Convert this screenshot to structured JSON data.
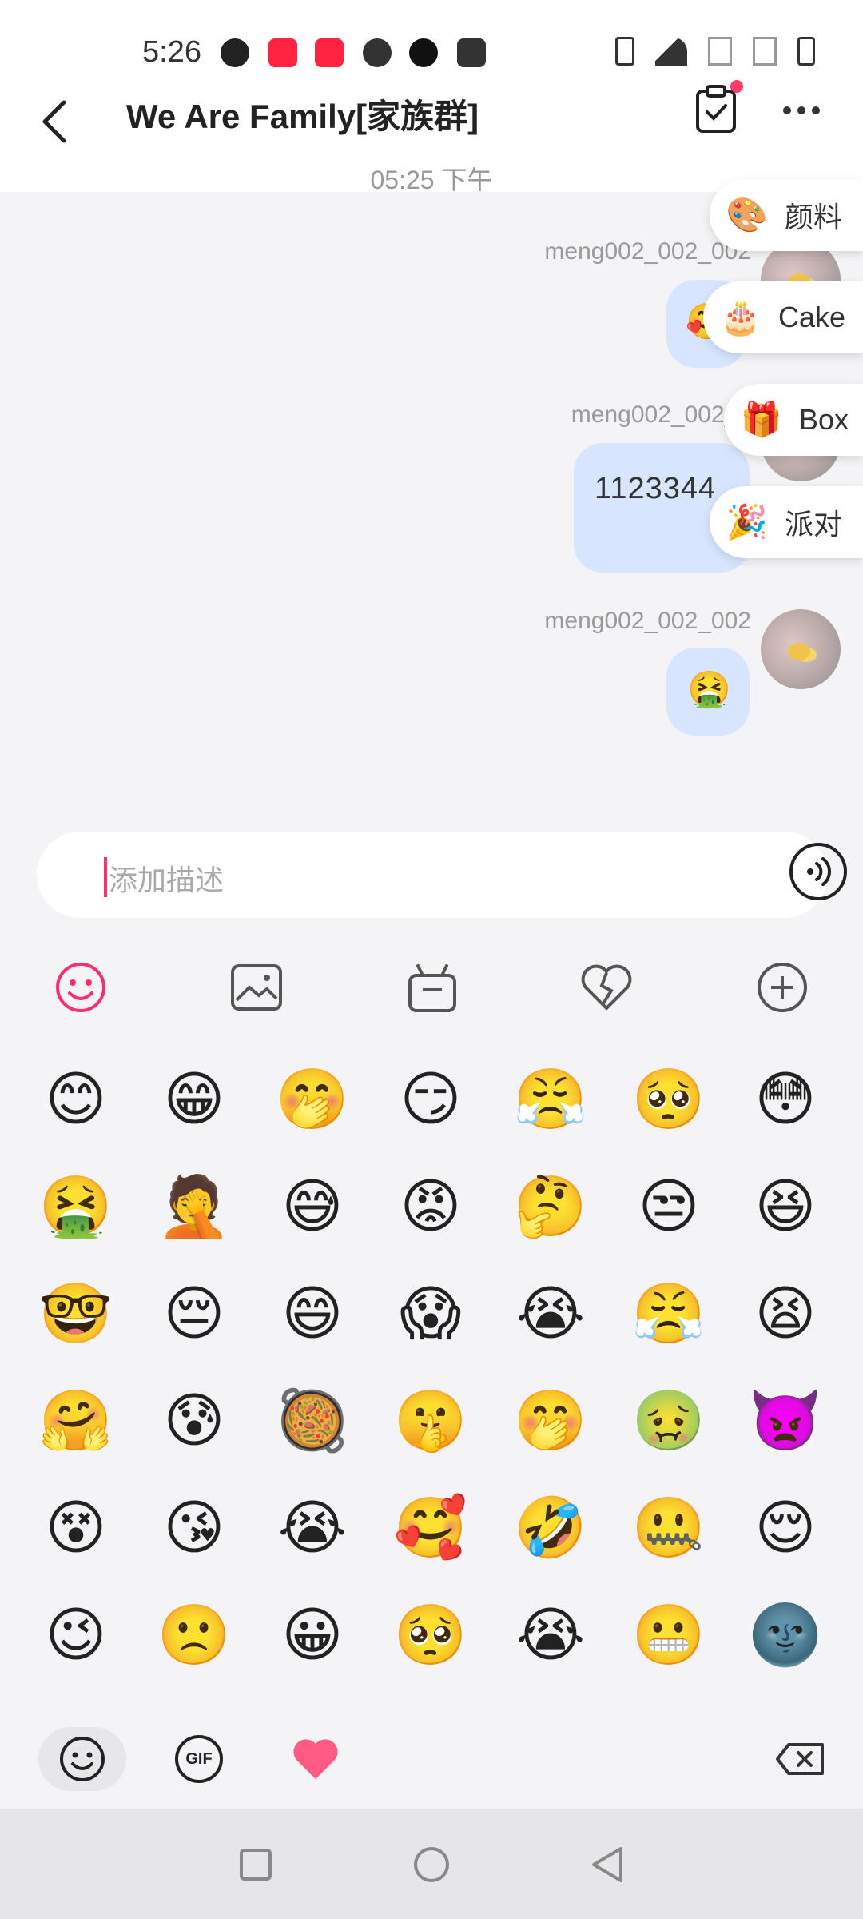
{
  "status_bar": {
    "time": "5:26",
    "apps": [
      "profile-app-icon",
      "xiaohongshu-icon",
      "xiaohongshu-icon",
      "facebook-icon",
      "tiktok-icon",
      "wallet-icon"
    ],
    "system": [
      "vibrate-icon",
      "wifi-icon",
      "no-signal-icon",
      "no-signal-icon",
      "battery-charging-icon"
    ]
  },
  "header": {
    "title": "We Are Family[家族群]"
  },
  "chat": {
    "timestamp": "05:25 下午",
    "messages": [
      {
        "sender": "meng002_002_002",
        "content": "🥰",
        "type": "emoji"
      },
      {
        "sender": "meng002_002_0",
        "content": "1123344",
        "type": "text"
      },
      {
        "sender": "meng002_002_002",
        "content": "🤮",
        "type": "emoji"
      }
    ]
  },
  "side_chips": [
    {
      "label": "颜料",
      "icon": "🎨"
    },
    {
      "label": "Cake",
      "icon": "🎂"
    },
    {
      "label": "Box",
      "icon": "🎁"
    },
    {
      "label": "派对",
      "icon": "🎉"
    }
  ],
  "input": {
    "placeholder": "添加描述"
  },
  "emojis": [
    "😊",
    "😁",
    "🤭",
    "😏",
    "😤",
    "🥺",
    "😳",
    "🤮",
    "🤦",
    "😅",
    "😡",
    "🤔",
    "😒",
    "😆",
    "🤓",
    "😔",
    "😄",
    "😱",
    "😭",
    "😤",
    "😫",
    "🤗",
    "😰",
    "🥘",
    "🤫",
    "🤭",
    "🤢",
    "👿",
    "😵",
    "😘",
    "😭",
    "🥰",
    "🤣",
    "🤐",
    "😌",
    "😉",
    "🙁",
    "😀",
    "🥺",
    "😭",
    "😬",
    "🌚"
  ],
  "bar": {
    "gif_label": "GIF"
  },
  "colors": {
    "accent": "#ff2d6b",
    "bubble": "#d7e5ff",
    "heart": "#ff5a84"
  }
}
